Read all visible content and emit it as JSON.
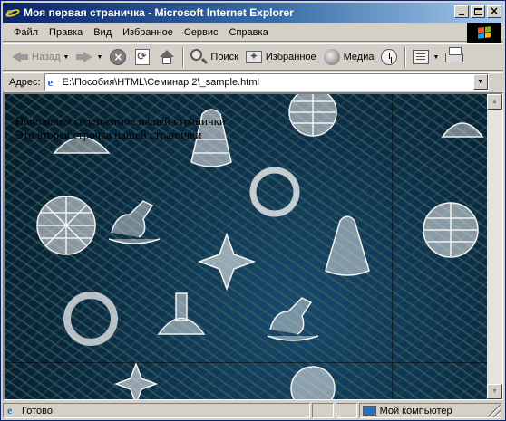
{
  "window": {
    "title": "Моя первая страничка - Microsoft Internet Explorer"
  },
  "menu": {
    "items": [
      "Файл",
      "Правка",
      "Вид",
      "Избранное",
      "Сервис",
      "Справка"
    ]
  },
  "toolbar": {
    "back_label": "Назад",
    "search_label": "Поиск",
    "favorites_label": "Избранное",
    "media_label": "Медиа"
  },
  "address": {
    "label": "Адрес:",
    "url": "E:\\Пособия\\HTML\\Семинар 2\\_sample.html"
  },
  "page": {
    "line1": "Наполняем содержимое нашей странички",
    "line2": "Это вторая строчка нашей странички"
  },
  "status": {
    "text": "Готово",
    "zone": "Мой компьютер"
  },
  "colors": {
    "titlebar_start": "#0a246a",
    "titlebar_end": "#a6caf0",
    "chrome": "#d4d0c8",
    "background_pattern": "#0e2a3d"
  },
  "icons": {
    "title": "ie-icon",
    "back": "back-arrow-icon",
    "forward": "forward-arrow-icon",
    "stop": "stop-icon",
    "refresh": "refresh-icon",
    "home": "home-icon",
    "search": "search-icon",
    "favorites": "favorites-icon",
    "media": "media-icon",
    "history": "history-icon",
    "mail": "mail-icon",
    "print": "print-icon",
    "page": "page-icon",
    "computer": "computer-icon"
  }
}
